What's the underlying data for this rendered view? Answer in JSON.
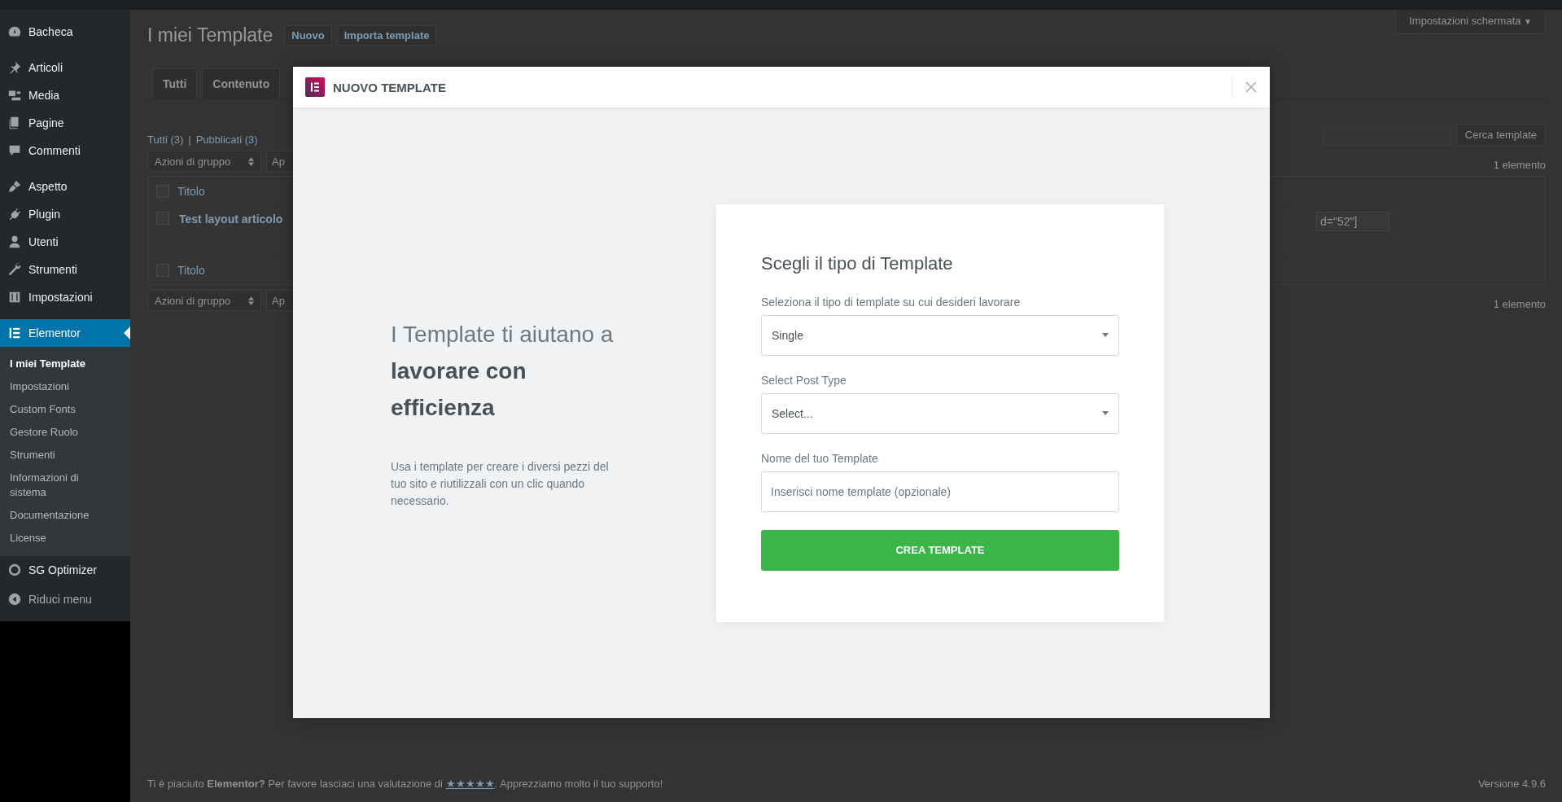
{
  "sidebar": {
    "groups": [
      {
        "items": [
          {
            "label": "Bacheca",
            "selected": false
          }
        ]
      },
      {
        "items": [
          {
            "label": "Articoli",
            "selected": false
          },
          {
            "label": "Media",
            "selected": false
          },
          {
            "label": "Pagine",
            "selected": false
          },
          {
            "label": "Commenti",
            "selected": false
          }
        ]
      },
      {
        "items": [
          {
            "label": "Aspetto",
            "selected": false
          },
          {
            "label": "Plugin",
            "selected": false
          },
          {
            "label": "Utenti",
            "selected": false
          },
          {
            "label": "Strumenti",
            "selected": false
          },
          {
            "label": "Impostazioni",
            "selected": false
          }
        ]
      },
      {
        "items": [
          {
            "label": "Elementor",
            "selected": true,
            "children": [
              {
                "label": "I miei Template",
                "selected": true
              },
              {
                "label": "Impostazioni",
                "selected": false
              },
              {
                "label": "Custom Fonts",
                "selected": false
              },
              {
                "label": "Gestore Ruolo",
                "selected": false
              },
              {
                "label": "Strumenti",
                "selected": false
              },
              {
                "label": "Informazioni di sistema",
                "selected": false
              },
              {
                "label": "Documentazione",
                "selected": false
              },
              {
                "label": "License",
                "selected": false
              }
            ]
          },
          {
            "label": "SG Optimizer",
            "selected": false
          }
        ]
      }
    ],
    "collapse": "Riduci menu"
  },
  "page": {
    "title": "I miei Template",
    "actions": [
      "Nuovo",
      "Importa template"
    ],
    "screen_options": "Impostazioni schermata",
    "screen_options_caret": "▼",
    "tabs": [
      {
        "label": "Tutti",
        "selected": false
      },
      {
        "label": "Contenuto",
        "selected": false
      }
    ],
    "filters": [
      {
        "label": "Tutti (3)"
      },
      {
        "label": "Pubblicati (3)"
      }
    ],
    "filter_separator": "|",
    "search_button": "Cerca template",
    "bulk_top": {
      "select": "Azioni di gruppo",
      "apply": "Ap",
      "count": "1 elemento"
    },
    "table": {
      "header": {
        "title": "Titolo",
        "checked": false
      },
      "rows": [
        {
          "title": "Test layout articolo",
          "shortcode": "d=\"52\"]",
          "checked": false
        }
      ],
      "footer": {
        "title": "Titolo",
        "checked": false
      }
    },
    "bulk_bottom": {
      "select": "Azioni di gruppo",
      "apply": "Ap",
      "count": "1 elemento"
    },
    "footer": {
      "before": "Ti è piaciuto **Elementor?** Per favore lasciaci una valutazione di ",
      "link": "★★★★★",
      "after": ". Apprezziamo molto il tuo supporto!",
      "version": "Versione 4.9.6"
    }
  },
  "modal": {
    "title": "NUOVO TEMPLATE",
    "headline": "I Template ti aiutano a **lavorare con efficienza**",
    "description": "Usa i template per creare i diversi pezzi del tuo sito e riutilizzali con un clic quando necessario.",
    "form": {
      "title": "Scegli il tipo di Template",
      "fields": [
        {
          "kind": "select",
          "label": "Seleziona il tipo di template su cui desideri lavorare",
          "value": "Single"
        },
        {
          "kind": "select",
          "label": "Select Post Type",
          "value": "Select..."
        },
        {
          "kind": "text",
          "label": "Nome del tuo Template",
          "placeholder": "Inserisci nome template (opzionale)"
        }
      ],
      "submit": "CREA TEMPLATE"
    }
  }
}
